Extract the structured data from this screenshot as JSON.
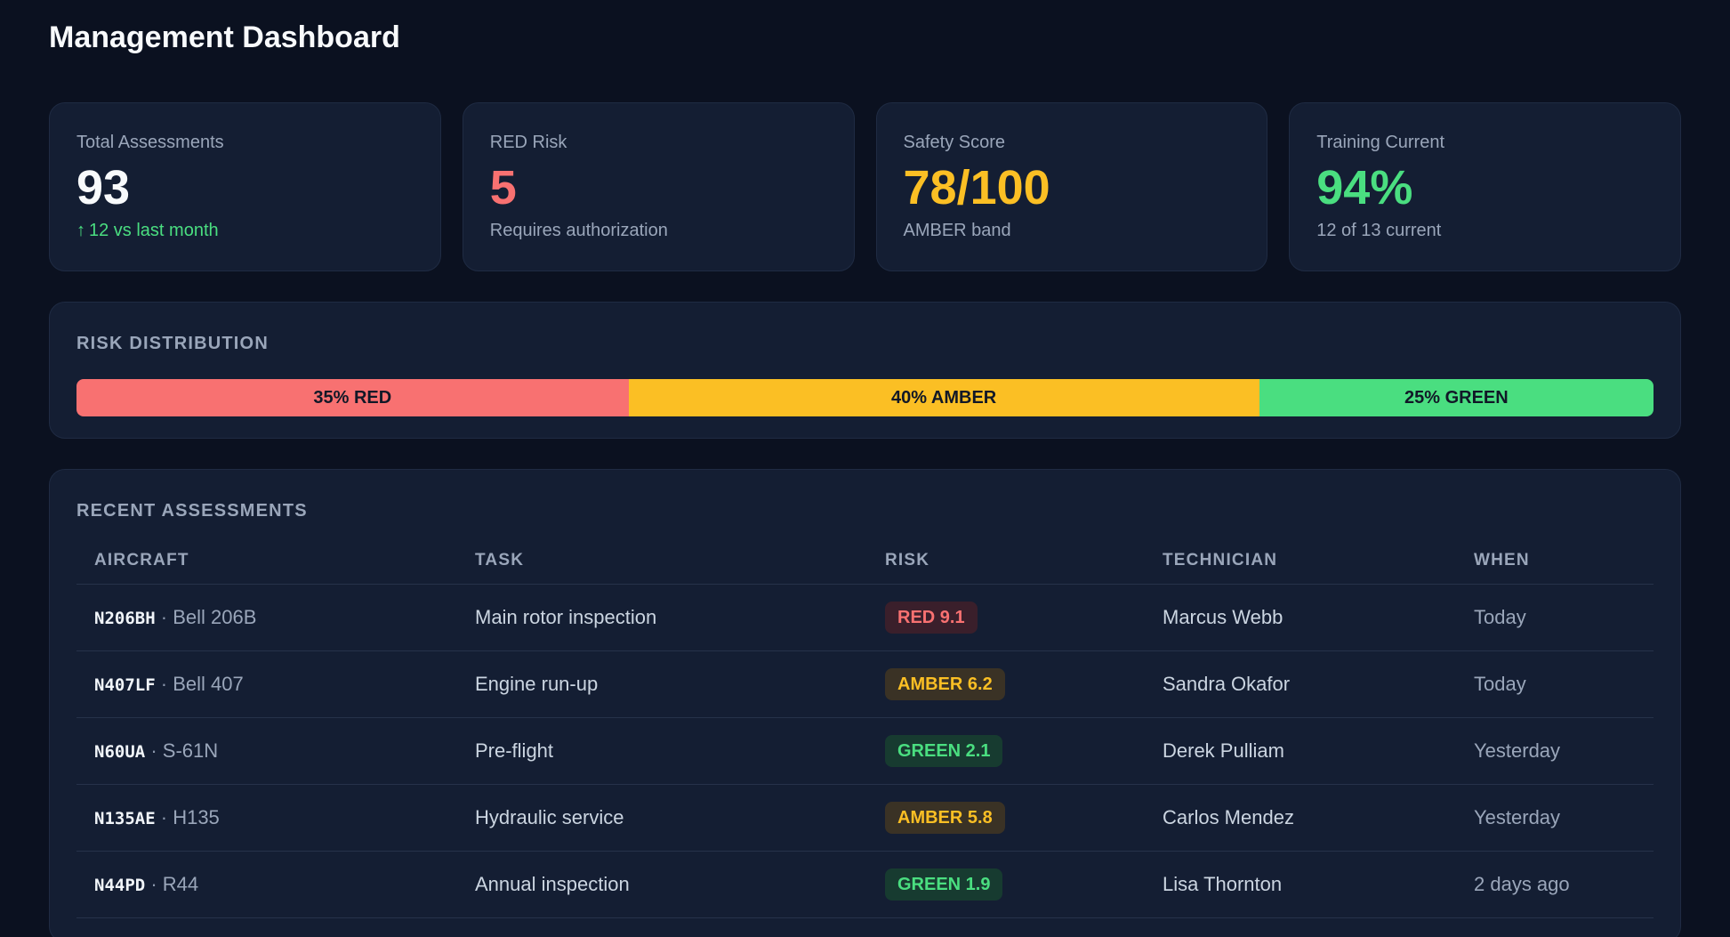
{
  "header": {
    "title": "Management Dashboard"
  },
  "stats": [
    {
      "label": "Total Assessments",
      "value": "93",
      "sub": "12 vs last month",
      "tone": "neutral",
      "trend": true
    },
    {
      "label": "RED Risk",
      "value": "5",
      "sub": "Requires authorization",
      "tone": "red",
      "trend": false
    },
    {
      "label": "Safety Score",
      "value": "78/100",
      "sub": "AMBER band",
      "tone": "amber",
      "trend": false
    },
    {
      "label": "Training Current",
      "value": "94%",
      "sub": "12 of 13 current",
      "tone": "green",
      "trend": false
    }
  ],
  "risk_distribution": {
    "title": "RISK DISTRIBUTION",
    "segments": [
      {
        "label": "35% RED",
        "percent": 35,
        "tone": "red"
      },
      {
        "label": "40% AMBER",
        "percent": 40,
        "tone": "amber"
      },
      {
        "label": "25% GREEN",
        "percent": 25,
        "tone": "green"
      }
    ]
  },
  "recent": {
    "title": "RECENT ASSESSMENTS",
    "columns": [
      "AIRCRAFT",
      "TASK",
      "RISK",
      "TECHNICIAN",
      "WHEN"
    ],
    "rows": [
      {
        "tail": "N206BH",
        "model": "Bell 206B",
        "task": "Main rotor inspection",
        "risk": "RED 9.1",
        "tone": "red",
        "technician": "Marcus Webb",
        "when": "Today"
      },
      {
        "tail": "N407LF",
        "model": "Bell 407",
        "task": "Engine run-up",
        "risk": "AMBER 6.2",
        "tone": "amber",
        "technician": "Sandra Okafor",
        "when": "Today"
      },
      {
        "tail": "N60UA",
        "model": "S-61N",
        "task": "Pre-flight",
        "risk": "GREEN 2.1",
        "tone": "green",
        "technician": "Derek Pulliam",
        "when": "Yesterday"
      },
      {
        "tail": "N135AE",
        "model": "H135",
        "task": "Hydraulic service",
        "risk": "AMBER 5.8",
        "tone": "amber",
        "technician": "Carlos Mendez",
        "when": "Yesterday"
      },
      {
        "tail": "N44PD",
        "model": "R44",
        "task": "Annual inspection",
        "risk": "GREEN 1.9",
        "tone": "green",
        "technician": "Lisa Thornton",
        "when": "2 days ago"
      }
    ]
  },
  "colors": {
    "red": "#f87171",
    "amber": "#fbbf24",
    "green": "#4ade80",
    "background": "#0b1120",
    "card": "#141e33"
  },
  "icons": {
    "trend": "arrow-up-icon"
  }
}
